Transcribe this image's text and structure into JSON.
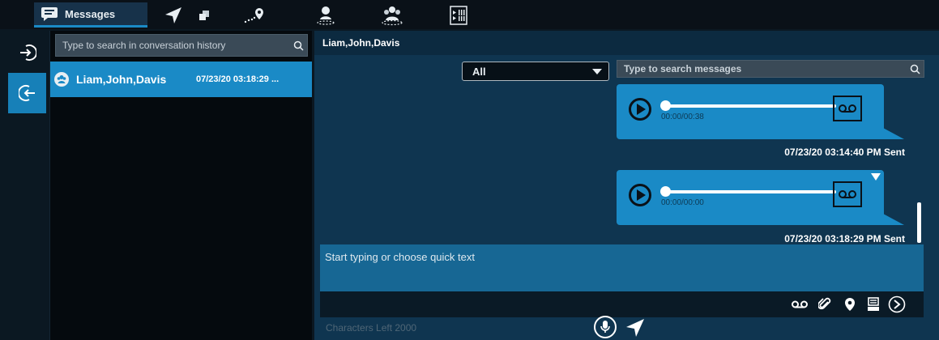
{
  "tabs": {
    "messages_label": "Messages"
  },
  "conversations": {
    "search_placeholder": "Type to search in conversation history",
    "items": [
      {
        "name": "Liam,John,Davis",
        "time": "07/23/20 03:18:29 ..."
      }
    ]
  },
  "chat": {
    "header_title": "Liam,John,Davis",
    "filter_selected": "All",
    "search_placeholder": "Type to search messages",
    "messages": [
      {
        "duration": "00:00/00:38",
        "timestamp": "07/23/20 03:14:40 PM Sent"
      },
      {
        "duration": "00:00/00:00",
        "timestamp": "07/23/20 03:18:29 PM Sent"
      }
    ],
    "compose_placeholder": "Start typing or choose quick text",
    "chars_left": "Characters Left 2000"
  },
  "colors": {
    "accent": "#1a8ac6",
    "background": "#0b1822",
    "chat_bg": "#0f3550"
  }
}
